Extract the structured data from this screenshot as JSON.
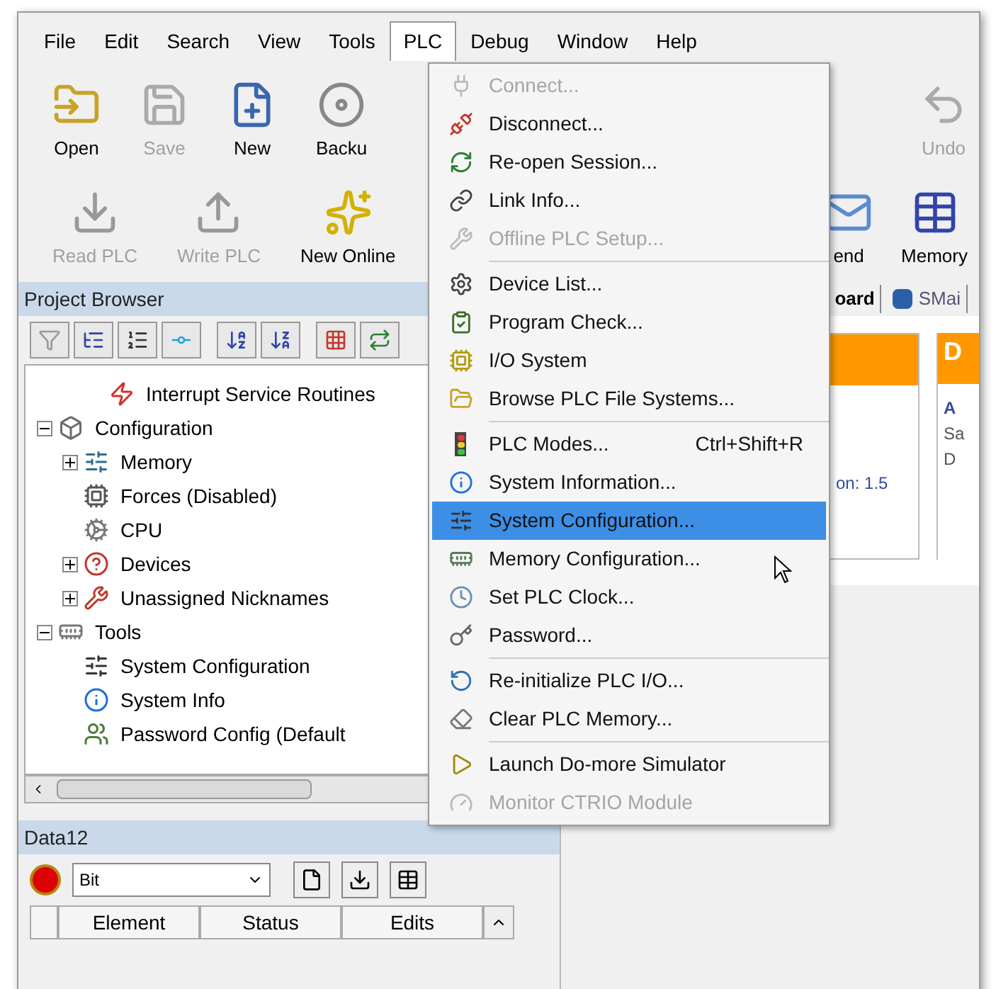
{
  "menu_bar": [
    {
      "label": "File",
      "selected": false
    },
    {
      "label": "Edit",
      "selected": false
    },
    {
      "label": "Search",
      "selected": false
    },
    {
      "label": "View",
      "selected": false
    },
    {
      "label": "Tools",
      "selected": false
    },
    {
      "label": "PLC",
      "selected": true
    },
    {
      "label": "Debug",
      "selected": false
    },
    {
      "label": "Window",
      "selected": false
    },
    {
      "label": "Help",
      "selected": false
    }
  ],
  "toolbar_rows": [
    {
      "left": [
        {
          "label": "Open",
          "disabled": false
        },
        {
          "label": "Save",
          "disabled": true
        },
        {
          "label": "New",
          "disabled": false
        },
        {
          "label": "Backu",
          "disabled": false
        }
      ],
      "right": [
        {
          "label": "Undo",
          "disabled": true
        }
      ]
    },
    {
      "left": [
        {
          "label": "Read PLC",
          "disabled": true
        },
        {
          "label": "Write PLC",
          "disabled": true
        },
        {
          "label": "New Online",
          "disabled": false
        }
      ],
      "right": [
        {
          "label": "end",
          "disabled": false
        },
        {
          "label": "Memory",
          "disabled": false
        }
      ]
    }
  ],
  "project_browser": {
    "title": "Project Browser",
    "tree": [
      {
        "kind": "continued",
        "label": "Interrupt Service Routines"
      },
      {
        "kind": "node",
        "label": "Configuration",
        "expanded": true,
        "children": [
          {
            "kind": "node",
            "label": "Memory",
            "expanded": false
          },
          {
            "kind": "node",
            "label": "Forces (Disabled)"
          },
          {
            "kind": "node",
            "label": "CPU"
          },
          {
            "kind": "node",
            "label": "Devices",
            "expanded": false
          },
          {
            "kind": "node",
            "label": "Unassigned Nicknames",
            "expanded": false
          }
        ]
      },
      {
        "kind": "node",
        "label": "Tools",
        "expanded": true,
        "children": [
          {
            "kind": "node",
            "label": "System Configuration"
          },
          {
            "kind": "node",
            "label": "System Info"
          },
          {
            "kind": "node",
            "label": "Password Config (Default"
          }
        ]
      }
    ]
  },
  "data_panel": {
    "title": "Data12",
    "type_select": {
      "value": "Bit"
    },
    "columns": [
      "Element",
      "Status",
      "Edits"
    ]
  },
  "editor": {
    "tabs": [
      {
        "label": "oard",
        "selected": true
      },
      {
        "label": "SMai",
        "selected": false
      }
    ],
    "card_text": "on: 1.5",
    "right_card": {
      "header": "D",
      "lines": [
        "A",
        "Sa",
        "D"
      ]
    }
  },
  "plc_menu": {
    "items": [
      {
        "label": "Connect...",
        "disabled": true,
        "selected": false,
        "separator_before": false
      },
      {
        "label": "Disconnect...",
        "disabled": false,
        "selected": false,
        "separator_before": false
      },
      {
        "label": "Re-open Session...",
        "disabled": false,
        "selected": false,
        "separator_before": false
      },
      {
        "label": "Link Info...",
        "disabled": false,
        "selected": false,
        "separator_before": false
      },
      {
        "label": "Offline PLC Setup...",
        "disabled": true,
        "selected": false,
        "separator_before": false
      },
      {
        "label": "Device List...",
        "disabled": false,
        "selected": false,
        "separator_before": true
      },
      {
        "label": "Program Check...",
        "disabled": false,
        "selected": false,
        "separator_before": false
      },
      {
        "label": "I/O System",
        "disabled": false,
        "selected": false,
        "separator_before": false
      },
      {
        "label": "Browse PLC File Systems...",
        "disabled": false,
        "selected": false,
        "separator_before": false
      },
      {
        "label": "PLC Modes...",
        "shortcut": "Ctrl+Shift+R",
        "disabled": false,
        "selected": false,
        "separator_before": true
      },
      {
        "label": "System Information...",
        "disabled": false,
        "selected": false,
        "separator_before": false
      },
      {
        "label": "System Configuration...",
        "disabled": false,
        "selected": true,
        "separator_before": false
      },
      {
        "label": "Memory Configuration...",
        "disabled": false,
        "selected": false,
        "separator_before": false
      },
      {
        "label": "Set PLC Clock...",
        "disabled": false,
        "selected": false,
        "separator_before": false
      },
      {
        "label": "Password...",
        "disabled": false,
        "selected": false,
        "separator_before": false
      },
      {
        "label": "Re-initialize PLC I/O...",
        "disabled": false,
        "selected": false,
        "separator_before": true
      },
      {
        "label": "Clear PLC Memory...",
        "disabled": false,
        "selected": false,
        "separator_before": false
      },
      {
        "label": "Launch Do-more Simulator",
        "disabled": false,
        "selected": false,
        "separator_before": true
      },
      {
        "label": "Monitor CTRIO Module",
        "disabled": true,
        "selected": false,
        "separator_before": false
      }
    ]
  }
}
